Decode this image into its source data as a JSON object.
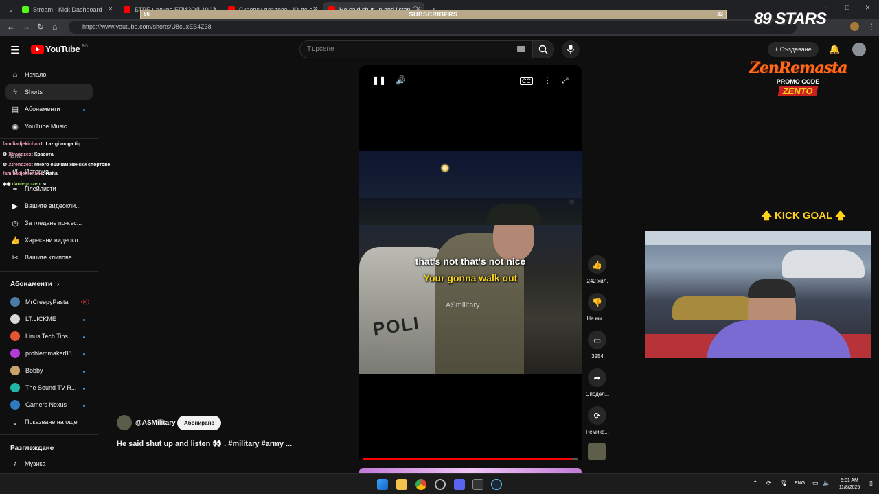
{
  "browser": {
    "tabs": [
      {
        "label": "Stream - Kick Dashboard",
        "favicon_color": "#53fc18"
      },
      {
        "label": "БТРЕ налива ЕПИЗОД 10 \"А...",
        "favicon_color": "#ff0000"
      },
      {
        "label": "Скрепки пазлове - Къде е 3...",
        "favicon_color": "#ff0000"
      },
      {
        "label": "He said shut up and listen 🗣...",
        "favicon_color": "#ff0000"
      }
    ],
    "url": "https://www.youtube.com/shorts/U8cuxEB4Z38"
  },
  "overlay": {
    "subscribers_label": "SUBSCRIBERS",
    "subscribers_current": "56",
    "subscribers_goal": "33",
    "stars_brand": "89 STARS",
    "promo_brand": "ZenRemasta",
    "promo_label": "PROMO CODE",
    "promo_code": "ZENTO",
    "kick_goal": "KICK GOAL"
  },
  "youtube": {
    "logo": "YouTube",
    "region": "BG",
    "search_placeholder": "Търсене",
    "create_label": "Създаване"
  },
  "sidebar": {
    "items": [
      {
        "icon": "home-icon",
        "label": "Начало"
      },
      {
        "icon": "shorts-icon",
        "label": "Shorts"
      },
      {
        "icon": "subscriptions-icon",
        "label": "Абонаменти"
      },
      {
        "icon": "youtube-music-icon",
        "label": "YouTube Music"
      }
    ],
    "you_items": [
      {
        "icon": "history-icon",
        "label": "История"
      },
      {
        "icon": "playlists-icon",
        "label": "Плейлисти"
      },
      {
        "icon": "your-videos-icon",
        "label": "Вашите видеокли..."
      },
      {
        "icon": "watch-later-icon",
        "label": "За гледане по-къс..."
      },
      {
        "icon": "liked-icon",
        "label": "Харесани видеокл..."
      },
      {
        "icon": "clips-icon",
        "label": "Вашите клипове"
      }
    ],
    "you_heading": "Вие",
    "subscriptions_heading": "Абонаменти",
    "subscriptions": [
      {
        "label": "MrCreepyPasta",
        "color": "#4a7ca8"
      },
      {
        "label": "LT.LICKME",
        "color": "#d8d8d8"
      },
      {
        "label": "Linus Tech Tips",
        "color": "#e4572e"
      },
      {
        "label": "problemmaker88",
        "color": "#b43bd8"
      },
      {
        "label": "Bobby",
        "color": "#c9a36b"
      },
      {
        "label": "The Sound TV R...",
        "color": "#1fb8a6"
      },
      {
        "label": "Gamers Nexus",
        "color": "#2e7bc4"
      }
    ],
    "show_more": "Показване на още",
    "explore_heading": "Разглеждане",
    "explore_items": [
      {
        "icon": "music-icon",
        "label": "Музика"
      }
    ]
  },
  "chat": [
    {
      "user": "familiadjekichan1",
      "msg": ": I az gi moga tiq"
    },
    {
      "user": "Xtrendzex",
      "msg": ": Красота"
    },
    {
      "user": "Xtrendzex",
      "msg": ": Много обичам женски спортове"
    },
    {
      "user": "familiadjekichan1",
      "msg": ": Haha"
    },
    {
      "user": "daniegrozen",
      "msg": ": я"
    }
  ],
  "video": {
    "subtitle_line1": "that's not that's not nice",
    "subtitle_line2": "Your gonna walk out",
    "watermark": "ASmilitary",
    "car_text": "POLI",
    "progress": 0.97
  },
  "actions": [
    {
      "icon": "like-icon",
      "label": "242 хил."
    },
    {
      "icon": "dislike-icon",
      "label": "Не ми ..."
    },
    {
      "icon": "comment-icon",
      "label": "3954"
    },
    {
      "icon": "share-icon",
      "label": "Сподел..."
    },
    {
      "icon": "remix-icon",
      "label": "Ремикс..."
    }
  ],
  "channel": {
    "handle": "@ASMilitary",
    "subscribe_label": "Абониране",
    "title": "He said shut up and listen 👀 . #military #army ..."
  },
  "taskbar": {
    "lang": "ENG",
    "time": "5:01 AM",
    "date": "11/8/2025"
  }
}
